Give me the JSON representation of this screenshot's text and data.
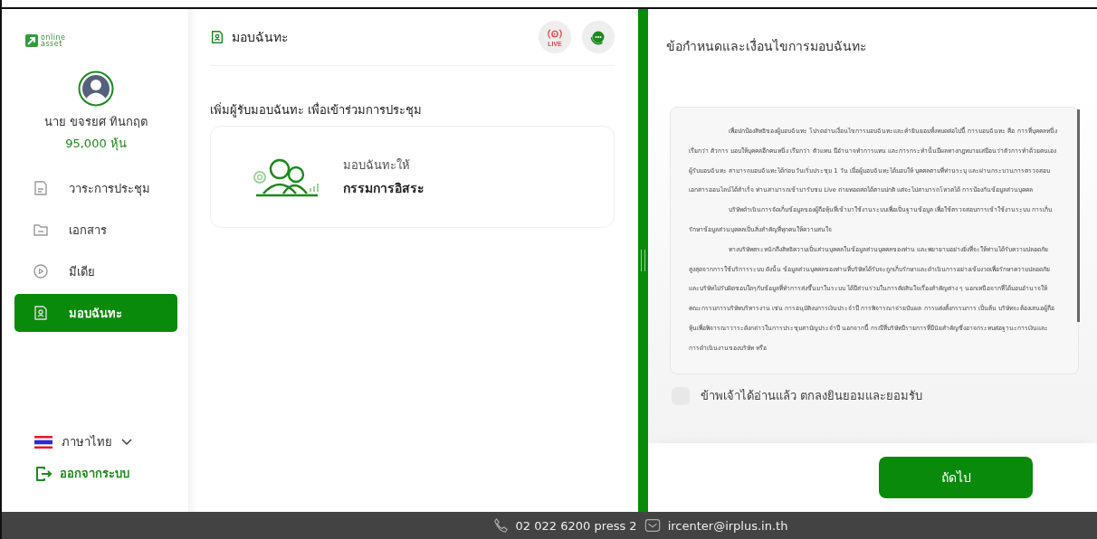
{
  "sidebar": {
    "logo": {
      "line_1": "online",
      "line_2": "asset"
    },
    "user": {
      "name": "นาย ขจรยศ ทินกฤต",
      "shares": "95,000 หุ้น"
    },
    "items": [
      {
        "label": "วาระการประชุม",
        "kind": "agenda",
        "selected": false
      },
      {
        "label": "เอกสาร",
        "kind": "folder",
        "selected": false
      },
      {
        "label": "มีเดีย",
        "kind": "media",
        "selected": false
      },
      {
        "label": "มอบฉันทะ",
        "kind": "proxy",
        "selected": true
      }
    ],
    "language": "ภาษาไทย",
    "logout": "ออกจากระบบ"
  },
  "main": {
    "title": "มอบฉันทะ",
    "live_label": "LIVE",
    "section": "เพิ่มผู้รับมอบฉันทะ เพื่อเข้าร่วมการประชุม",
    "option": {
      "caption": "มอบฉันทะให้",
      "title": "กรรมการอิสระ"
    }
  },
  "terms": {
    "title": "ข้อกำหนดและเงื่อนไขการมอบฉันทะ",
    "paragraphs": [
      "เพื่อปกป้องสิทธิของผู้มอบฉันทะ โปรดอ่านเงื่อนไขการมอบฉันทะและคำยินยอมทั้งหมดต่อไปนี้ การมอบฉันทะ คือ การที่บุคคลหนึ่งเรียกว่า ตัวการ มอบให้บุคคลอีกคนหนึ่ง เรียกว่า ตัวแทน มีอำนาจทำการแทน และการกระทำนั้นมีผลทางกฎหมายเสมือนว่าตัวการทำด้วยตนเอง ผู้รับมอบฉันทะ สามารถมอบฉันทะได้ก่อนวันเริ่มประชุม 1 วัน เมื่อผู้มอบฉันทะได้มอบให้ บุคคลตามที่ท่านระบุ และผ่านกระบวนการตรวจสอบเอกสารออนไลน์ได้สำเร็จ ท่านสามารถเข้ามารับชม Live ถ่ายทอดสดได้ตามปกติ แต่จะไม่สามารถโหวตได้ การป้องกันข้อมูลส่วนบุคคล",
      "บริษัทดำเนินการจัดเก็บข้อมูลของผู้ถือหุ้นที่เข้ามาใช้งานระบบเพื่อเป็นฐานข้อมูล เพื่อใช้ตรวจสอบการเข้าใช้งานระบบ การเก็บรักษาข้อมูลส่วนบุคคลเป็นสิ่งสำคัญที่ทุกคนให้ความสนใจ",
      "ทางบริษัทตระหนักถึงสิทธิความเป็นส่วนบุคคลในข้อมูลส่วนบุคคลของท่าน และพยายามอย่างยิ่งที่จะให้ท่านได้รับความปลอดภัยสูงสุดจากการใช้บริการระบบ ดังนั้น ข้อมูลส่วนบุคคลของท่านที่บริษัทได้รับจะถูกเก็บรักษาและดำเนินการอย่างเข้มงวดเพื่อรักษาความปลอดภัย และบริษัทไม่รับผิดชอบใดๆกับข้อมูลที่ทำการส่งขึ้นมาในระบบ ได้มีส่วนร่วมในการตัดสินใจเรื่องสำคัญต่าง ๆ นอกเหนือจากที่ได้มอบอำนาจให้คณะกรรมการบริษัทบริหารงาน เช่น การอนุมัติงบการเงินประจำปี การพิจารณาจ่ายปันผล การแต่งตั้งกรรมการ เป็นต้น บริษัทจะต้องเสนอผู้ถือหุ้นเพื่อพิจารณาวาระดังกล่าวในการประชุมสามัญประจำปี นอกจากนี้ กรณีที่บริษัทมีรายการที่มีนัยสำคัญซึ่งอาจกระทบต่อฐานะการเงินและการดำเนินงานของบริษัท หรือ"
    ],
    "agree": {
      "label": "ข้าพเจ้าได้อ่านแล้ว ตกลงยินยอมและยอมรับ",
      "checked": false
    },
    "next_button": "ถัดไป"
  },
  "footer": {
    "phone": "02 022 6200 press 2",
    "email": "ircenter@irplus.in.th"
  }
}
